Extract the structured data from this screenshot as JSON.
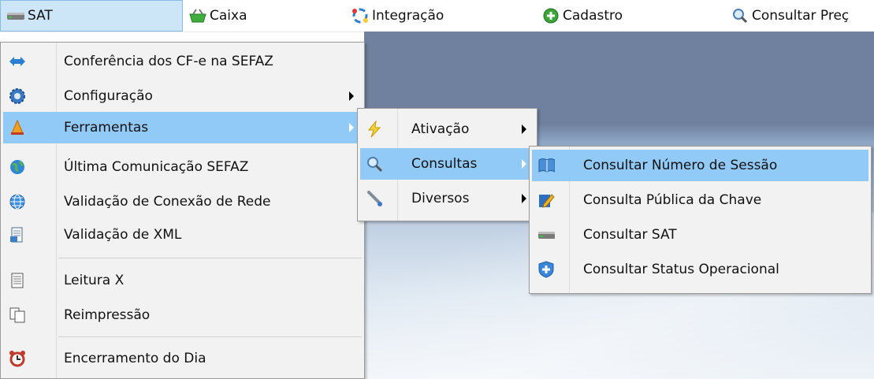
{
  "menubar": {
    "items": [
      {
        "label": "SAT",
        "icon": "sat-device-icon"
      },
      {
        "label": "Caixa",
        "icon": "basket-icon"
      },
      {
        "label": "Integração",
        "icon": "integration-icon"
      },
      {
        "label": "Cadastro",
        "icon": "add-circle-icon"
      },
      {
        "label": "Consultar Preç",
        "icon": "magnifier-icon"
      }
    ]
  },
  "sat_menu": {
    "items": [
      {
        "label": "Conferência dos CF-e na SEFAZ",
        "icon": "double-arrow-icon"
      },
      {
        "label": "Configuração",
        "icon": "gear-icon"
      },
      {
        "label": "Ferramentas",
        "icon": "tools-icon"
      },
      {
        "label": "Última Comunicação SEFAZ",
        "icon": "globe-icon"
      },
      {
        "label": "Validação de Conexão de Rede",
        "icon": "network-globe-icon"
      },
      {
        "label": "Validação de XML",
        "icon": "xml-document-icon"
      },
      {
        "label": "Leitura X",
        "icon": "document-icon"
      },
      {
        "label": "Reimpressão",
        "icon": "copy-document-icon"
      },
      {
        "label": "Encerramento do Dia",
        "icon": "alarm-clock-icon"
      }
    ]
  },
  "ferramentas_menu": {
    "items": [
      {
        "label": "Ativação",
        "icon": "lightning-icon"
      },
      {
        "label": "Consultas",
        "icon": "magnifier-icon"
      },
      {
        "label": "Diversos",
        "icon": "wrench-icon"
      }
    ]
  },
  "consultas_menu": {
    "items": [
      {
        "label": "Consultar Número de Sessão",
        "icon": "book-icon"
      },
      {
        "label": "Consulta Pública da Chave",
        "icon": "edit-document-icon"
      },
      {
        "label": "Consultar SAT",
        "icon": "sat-device-icon"
      },
      {
        "label": "Consultar Status Operacional",
        "icon": "shield-icon"
      }
    ]
  },
  "colors": {
    "highlight": "#91c9f7",
    "active_menubar": "#cde6f7",
    "app_background": "#6f819f"
  }
}
